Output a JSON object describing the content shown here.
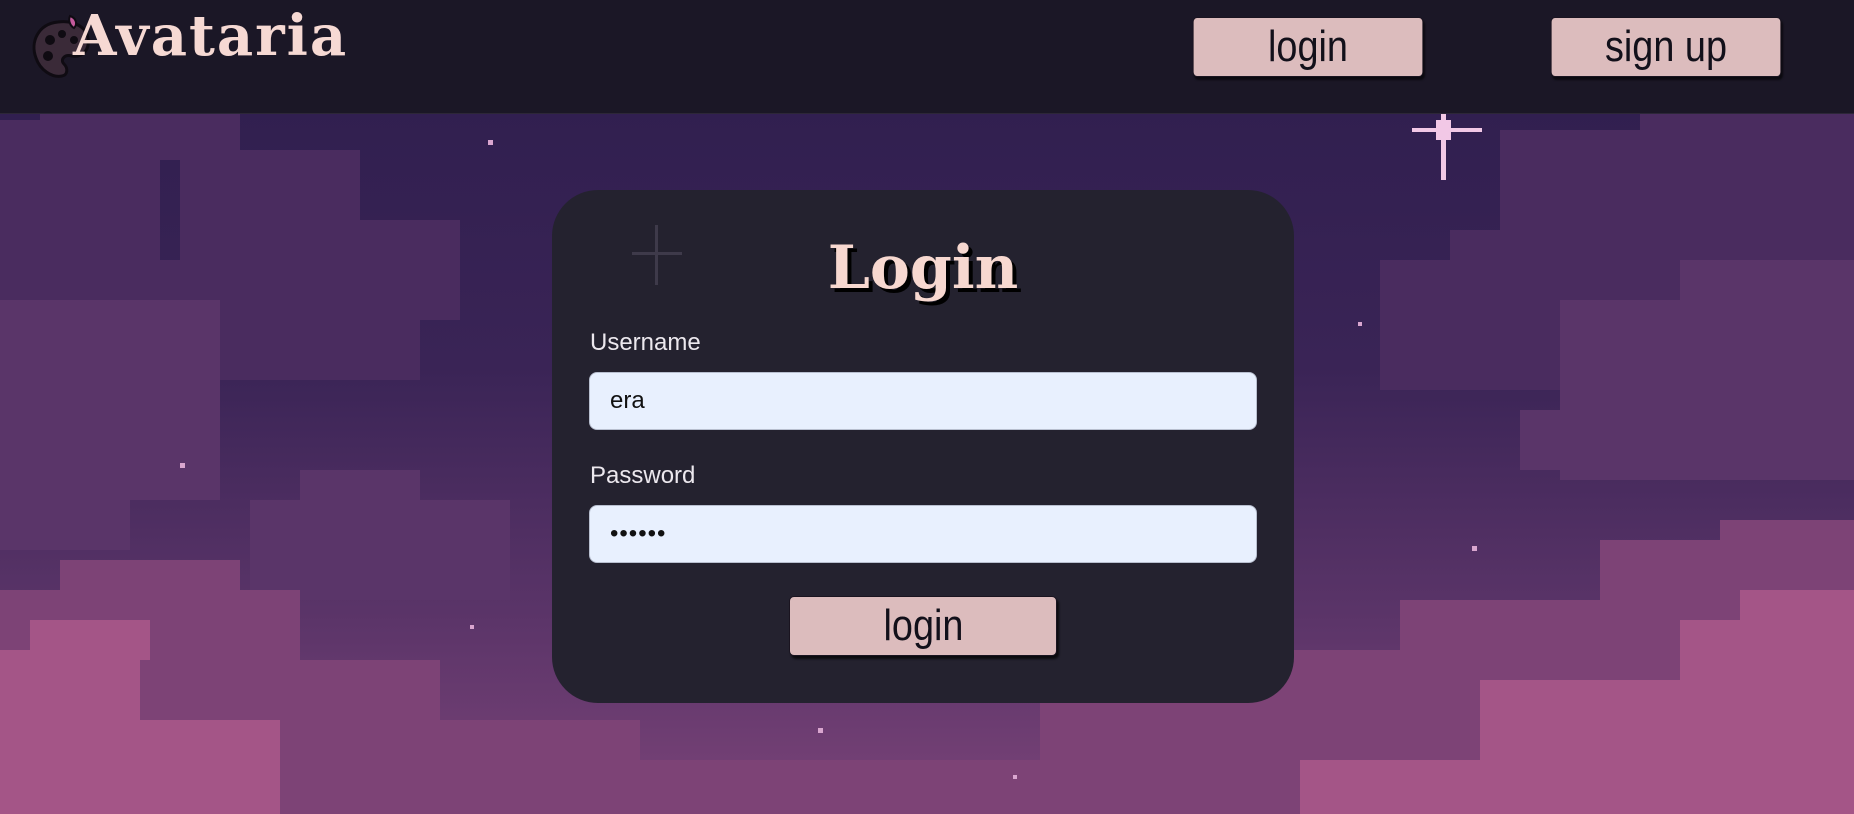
{
  "app": {
    "brand_name": "Avataria",
    "logo_icon": "paint-palette-icon"
  },
  "navbar": {
    "login_label": "login",
    "signup_label": "sign up"
  },
  "login_form": {
    "title": "Login",
    "username_label": "Username",
    "username_value": "era",
    "password_label": "Password",
    "password_value": "••••••",
    "submit_label": "login"
  },
  "colors": {
    "navbar_bg": "#1b1726",
    "card_bg": "#24222f",
    "button_bg": "#dcbcbd",
    "title_color": "#f7d8d0",
    "input_bg": "#e8f0fe"
  }
}
